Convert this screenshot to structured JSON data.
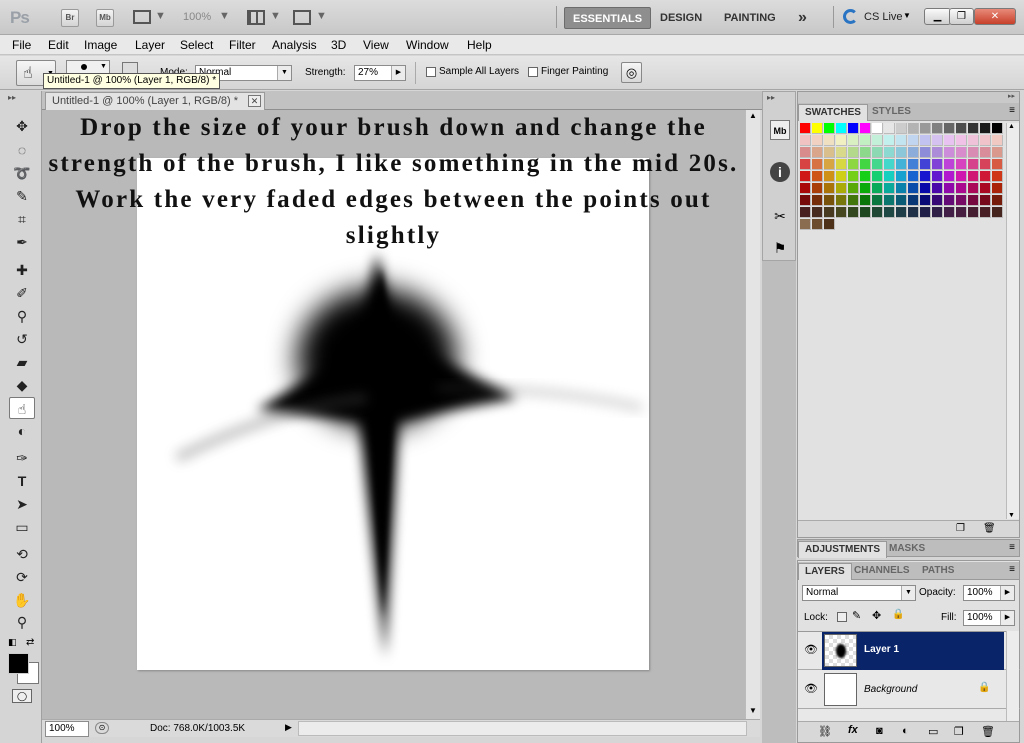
{
  "app": {
    "logo": "Ps",
    "bridge_label": "Br",
    "minibridge_label": "Mb",
    "zoom": "100%",
    "workspaces": [
      "ESSENTIALS",
      "DESIGN",
      "PAINTING"
    ],
    "more": "»",
    "cslive": "CS Live"
  },
  "menu": [
    "File",
    "Edit",
    "Image",
    "Layer",
    "Select",
    "Filter",
    "Analysis",
    "3D",
    "View",
    "Window",
    "Help"
  ],
  "options": {
    "mode_label": "Mode:",
    "mode_value": "Normal",
    "strength_label": "Strength:",
    "strength_value": "27%",
    "sample_all": "Sample All Layers",
    "finger_painting": "Finger Painting"
  },
  "tooltip": "Untitled-1 @ 100% (Layer 1, RGB/8) *",
  "document": {
    "tab_title": "Untitled-1 @ 100% (Layer 1, RGB/8) *",
    "overlay_text": "Drop the size of your brush down and change the strength of the brush, I like something in the mid 20s. Work the very faded edges between the points out slightly",
    "zoom": "100%",
    "doc_info": "Doc: 768.0K/1003.5K"
  },
  "panels": {
    "swatches_tab": "SWATCHES",
    "styles_tab": "STYLES",
    "adjustments_tab": "ADJUSTMENTS",
    "masks_tab": "MASKS",
    "layers_tab": "LAYERS",
    "channels_tab": "CHANNELS",
    "paths_tab": "PATHS",
    "blend_mode": "Normal",
    "opacity_label": "Opacity:",
    "opacity_value": "100%",
    "lock_label": "Lock:",
    "fill_label": "Fill:",
    "fill_value": "100%",
    "layers": [
      {
        "name": "Layer 1",
        "selected": true
      },
      {
        "name": "Background",
        "selected": false,
        "locked": true
      }
    ]
  },
  "colors": {
    "selection": "#0a246a",
    "foreground": "#000000",
    "background_color": "#ffffff"
  }
}
